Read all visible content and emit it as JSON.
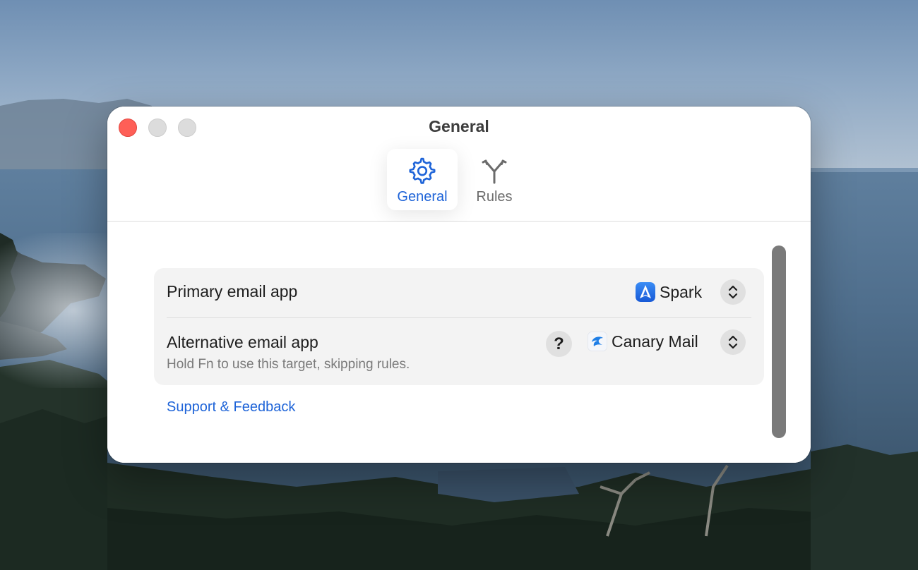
{
  "window": {
    "title": "General"
  },
  "toolbar": {
    "tabs": [
      {
        "label": "General",
        "icon": "gear-icon",
        "selected": true
      },
      {
        "label": "Rules",
        "icon": "branch-icon",
        "selected": false
      }
    ]
  },
  "settings": {
    "primary": {
      "label": "Primary email app",
      "value": "Spark",
      "value_icon": "spark-app-icon"
    },
    "alternative": {
      "label": "Alternative email app",
      "description": "Hold Fn to use this target, skipping rules.",
      "help_symbol": "?",
      "value": "Canary Mail",
      "value_icon": "canary-mail-app-icon"
    }
  },
  "links": {
    "support": "Support & Feedback"
  },
  "colors": {
    "accent": "#1d63d8",
    "close_button": "#fe5f57"
  }
}
